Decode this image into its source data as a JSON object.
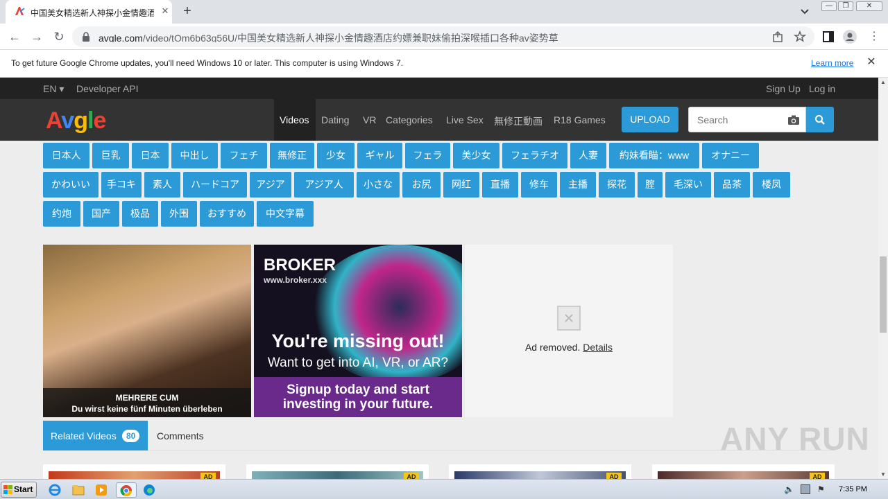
{
  "browser": {
    "tab_title": "中国美女精选新人神探小金情趣酒店",
    "tab_close": "✕",
    "new_tab": "+",
    "url_host": "avgle.com",
    "url_path": "/video/tOm6b63g56U/中国美女精选新人神探小金情趣酒店约嫖兼职妹偷拍深喉插口各种av姿势草"
  },
  "infobar": {
    "message": "To get future Google Chrome updates, you'll need Windows 10 or later. This computer is using Windows 7.",
    "learn_more": "Learn more",
    "close": "✕"
  },
  "site": {
    "topbar": {
      "lang": "EN ▾",
      "dev_api": "Developer API",
      "sign_up": "Sign Up",
      "login": "Log in"
    },
    "logo": {
      "letters": [
        "A",
        "v",
        "g",
        "l",
        "e"
      ],
      "colors": [
        "#ea4335",
        "#4285f4",
        "#fbbc05",
        "#34a853",
        "#ea4335"
      ]
    },
    "nav": [
      "Videos",
      "Dating",
      "VR",
      "Categories",
      "Live Sex",
      "無修正動画",
      "R18 Games"
    ],
    "upload": "UPLOAD",
    "search_placeholder": "Search",
    "accent": "#2b9ad6",
    "tags_row1": [
      "日本人",
      "巨乳",
      "日本",
      "中出し",
      "フェチ",
      "無修正",
      "少女",
      "ギャル",
      "フェラ",
      "美少女",
      "フェラチオ",
      "人妻",
      "約妹看瞄：www",
      "オナニー"
    ],
    "tags_row2": [
      "かわいい",
      "手コキ",
      "素人",
      "ハードコア",
      "アジア",
      "アジア人",
      "小さな",
      "お尻",
      "网红",
      "直播",
      "修车",
      "主播",
      "探花",
      "腟",
      "毛深い",
      "品茶",
      "楼凤"
    ],
    "tags_row3": [
      "约炮",
      "国产",
      "极品",
      "外围",
      "おすすめ",
      "中文字幕"
    ],
    "ad1": {
      "caption1": "MEHRERE CUM",
      "caption2": "Du wirst keine fünf Minuten überleben"
    },
    "ad2": {
      "brand": "BROKER",
      "site": "www.broker.xxx",
      "headline": "You're missing out!",
      "sub": "Want to get into AI, VR, or AR?",
      "cta1": "Signup today and start",
      "cta2": "investing in your future."
    },
    "ad3": {
      "text": "Ad removed.",
      "link": "Details"
    },
    "related": {
      "label": "Related Videos",
      "count": "80",
      "comments": "Comments"
    },
    "ad_badge": "AD",
    "watermark": "ANY RUN"
  },
  "taskbar": {
    "start": "Start",
    "clock": "7:35 PM"
  }
}
